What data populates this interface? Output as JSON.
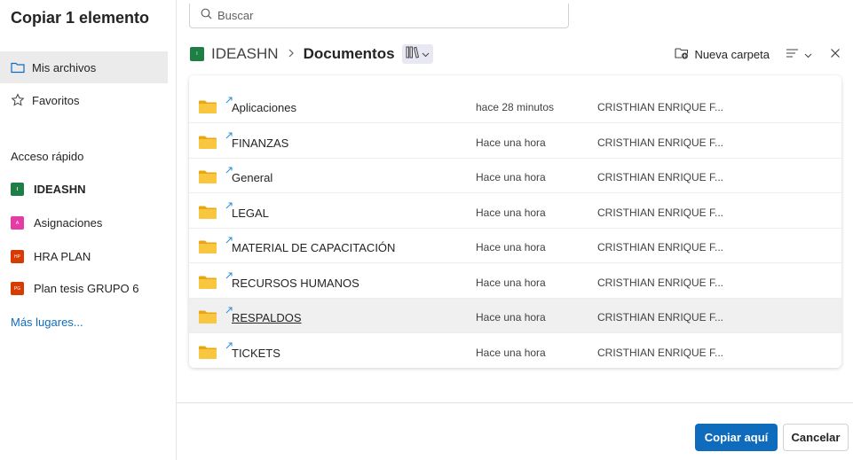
{
  "dialog": {
    "title": "Copiar 1 elemento"
  },
  "sidebar": {
    "nav": [
      {
        "label": "Mis archivos",
        "icon": "folder-icon"
      },
      {
        "label": "Favoritos",
        "icon": "star-icon"
      }
    ],
    "quick_access_label": "Acceso rápido",
    "quick_access": [
      {
        "label": "IDEASHN",
        "badge": "I",
        "color": "#1e7e45"
      },
      {
        "label": "Asignaciones",
        "badge": "A",
        "color": "#e43ba6"
      },
      {
        "label": "HRA PLAN",
        "badge": "HP",
        "color": "#d83b01"
      },
      {
        "label": "Plan tesis GRUPO 6",
        "badge": "PG",
        "color": "#d83b01"
      }
    ],
    "more_places": "Más lugares..."
  },
  "search": {
    "placeholder": "Buscar"
  },
  "breadcrumb": {
    "site": "IDEASHN",
    "site_badge": "I",
    "current": "Documentos"
  },
  "toolbar": {
    "new_folder": "Nueva carpeta"
  },
  "files": [
    {
      "name": "Aplicaciones",
      "modified": "hace 28 minutos",
      "modified_by": "CRISTHIAN ENRIQUE F..."
    },
    {
      "name": "FINANZAS",
      "modified": "Hace una hora",
      "modified_by": "CRISTHIAN ENRIQUE F..."
    },
    {
      "name": "General",
      "modified": "Hace una hora",
      "modified_by": "CRISTHIAN ENRIQUE F..."
    },
    {
      "name": "LEGAL",
      "modified": "Hace una hora",
      "modified_by": "CRISTHIAN ENRIQUE F..."
    },
    {
      "name": "MATERIAL DE CAPACITACIÓN",
      "modified": "Hace una hora",
      "modified_by": "CRISTHIAN ENRIQUE F..."
    },
    {
      "name": "RECURSOS HUMANOS",
      "modified": "Hace una hora",
      "modified_by": "CRISTHIAN ENRIQUE F..."
    },
    {
      "name": "RESPALDOS",
      "modified": "Hace una hora",
      "modified_by": "CRISTHIAN ENRIQUE F..."
    },
    {
      "name": "TICKETS",
      "modified": "Hace una hora",
      "modified_by": "CRISTHIAN ENRIQUE F..."
    }
  ],
  "footer": {
    "primary": "Copiar aquí",
    "secondary": "Cancelar"
  },
  "colors": {
    "accent": "#0f6cbd",
    "folder": "#f4b400",
    "sync": "#2d8fd5"
  }
}
